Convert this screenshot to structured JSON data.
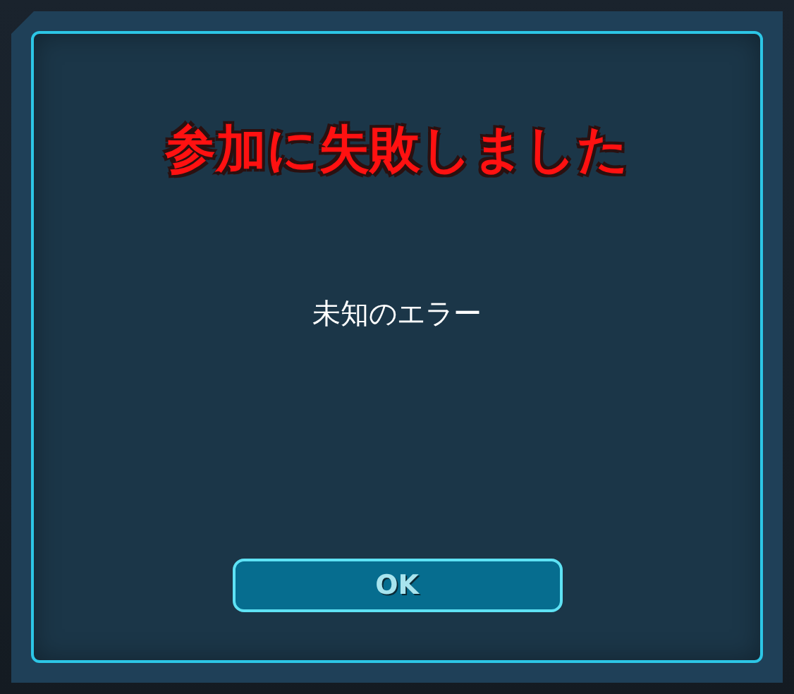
{
  "dialog": {
    "title": "参加に失敗しました",
    "message": "未知のエラー",
    "button": "OK"
  }
}
